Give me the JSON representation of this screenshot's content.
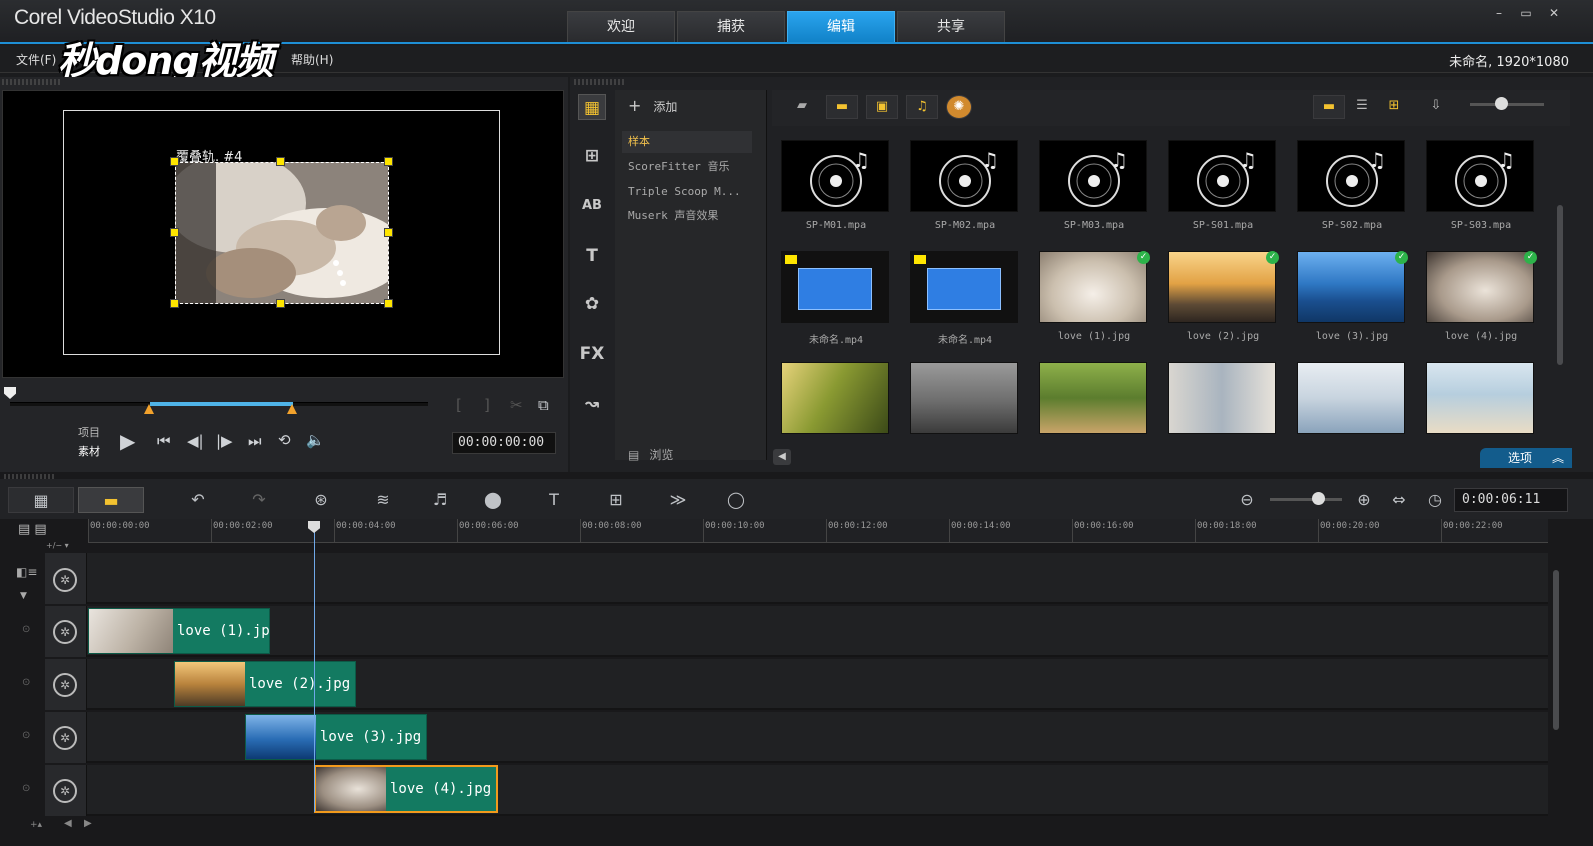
{
  "app": {
    "title": "Corel VideoStudio X10",
    "project_info": "未命名, 1920*1080",
    "watermark": "秒dong视频"
  },
  "tabs": [
    {
      "label": "欢迎",
      "active": false
    },
    {
      "label": "捕获",
      "active": false
    },
    {
      "label": "编辑",
      "active": true
    },
    {
      "label": "共享",
      "active": false
    }
  ],
  "menu": {
    "file": "文件(F)",
    "help": "帮助(H)"
  },
  "window_controls": {
    "minimize": "–",
    "restore": "▭",
    "close": "✕"
  },
  "preview": {
    "overlay_label": "覆叠轨. #4",
    "mode_project": "项目",
    "mode_clip": "素材",
    "timecode": "00:00:00:00"
  },
  "library": {
    "add_label": "添加",
    "browse_label": "浏览",
    "options_label": "选项",
    "list_items": [
      "样本",
      "ScoreFitter 音乐",
      "Triple Scoop M...",
      "Muserk 声音效果"
    ],
    "side_icons": [
      "media-icon",
      "instant-project-icon",
      "transition-icon",
      "title-icon",
      "graphic-icon",
      "filter-icon",
      "path-icon"
    ],
    "side_labels": {
      "transition": "AB",
      "title": "T",
      "filter": "FX"
    },
    "thumbnails": [
      {
        "caption": "SP-M01.mpa",
        "kind": "audio"
      },
      {
        "caption": "SP-M02.mpa",
        "kind": "audio"
      },
      {
        "caption": "SP-M03.mpa",
        "kind": "audio"
      },
      {
        "caption": "SP-S01.mpa",
        "kind": "audio"
      },
      {
        "caption": "SP-S02.mpa",
        "kind": "audio"
      },
      {
        "caption": "SP-S03.mpa",
        "kind": "audio"
      },
      {
        "caption": "未命名.mp4",
        "kind": "video-blue"
      },
      {
        "caption": "未命名.mp4",
        "kind": "video-blue"
      },
      {
        "caption": "love (1).jpg",
        "kind": "photo-hands",
        "checked": true
      },
      {
        "caption": "love (2).jpg",
        "kind": "photo-sunset",
        "checked": true
      },
      {
        "caption": "love (3).jpg",
        "kind": "photo-pier",
        "checked": true
      },
      {
        "caption": "love (4).jpg",
        "kind": "photo-sepia",
        "checked": true
      },
      {
        "caption": "",
        "kind": "photo-grass"
      },
      {
        "caption": "",
        "kind": "photo-bw"
      },
      {
        "caption": "",
        "kind": "photo-forest"
      },
      {
        "caption": "",
        "kind": "photo-street"
      },
      {
        "caption": "",
        "kind": "photo-couple"
      },
      {
        "caption": "",
        "kind": "photo-beach"
      }
    ]
  },
  "timeline": {
    "timecode": "0:00:06:11",
    "ruler": [
      "00:00:00:00",
      "00:00:02:00",
      "00:00:04:00",
      "00:00:06:00",
      "00:00:08:00",
      "00:00:10:00",
      "00:00:12:00",
      "00:00:14:00",
      "00:00:16:00",
      "00:00:18:00",
      "00:00:20:00",
      "00:00:22:00"
    ],
    "clips": [
      {
        "label": "love (1).jpg",
        "track": 1,
        "selected": false
      },
      {
        "label": "love (2).jpg",
        "track": 2,
        "selected": false
      },
      {
        "label": "love (3).jpg",
        "track": 3,
        "selected": false
      },
      {
        "label": "love (4).jpg",
        "track": 4,
        "selected": true
      }
    ]
  },
  "colors": {
    "accent": "#1e8fd5",
    "clip": "#137a61",
    "selection": "#f29a1c",
    "handle": "#ffe600"
  }
}
